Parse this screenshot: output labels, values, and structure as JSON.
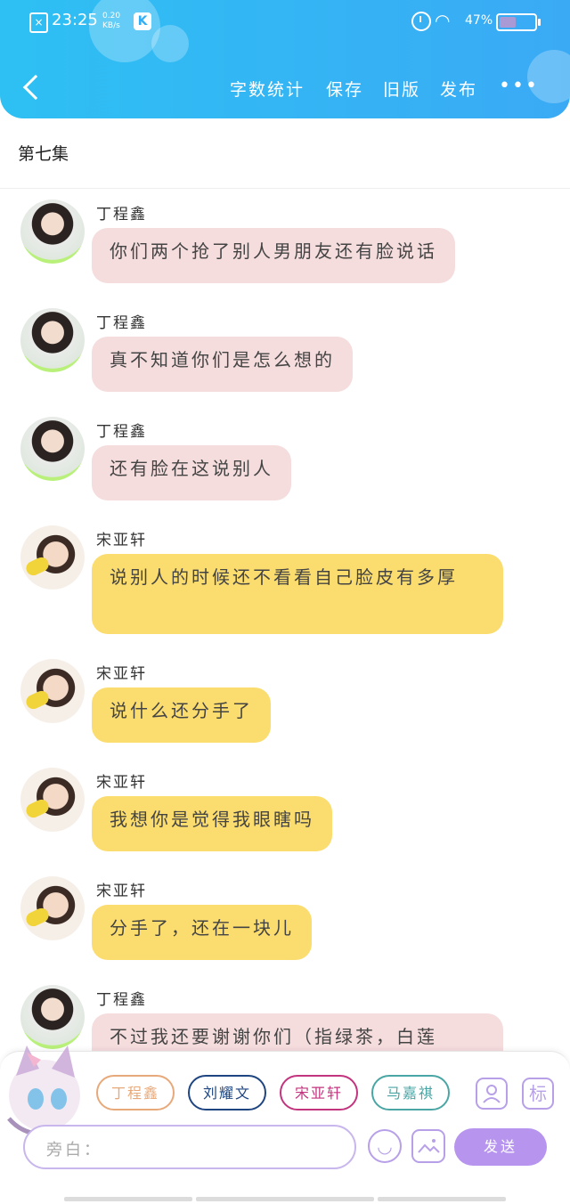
{
  "status_bar": {
    "time": "23:25",
    "speed_value": "0.20",
    "speed_unit": "KB/s",
    "app_badge": "K",
    "battery_pct": "47%",
    "battery_level": 0.47
  },
  "nav": {
    "word_count_label": "字数统计",
    "save_label": "保存",
    "old_version_label": "旧版",
    "publish_label": "发布",
    "more_label": "•••"
  },
  "episode_title": "第七集",
  "messages": [
    {
      "sender": "丁程鑫",
      "text": "你们两个抢了别人男朋友还有脸说话",
      "style": "pink"
    },
    {
      "sender": "丁程鑫",
      "text": "真不知道你们是怎么想的",
      "style": "pink"
    },
    {
      "sender": "丁程鑫",
      "text": "还有脸在这说别人",
      "style": "pink"
    },
    {
      "sender": "宋亚轩",
      "text": "说别人的时候还不看看自己脸皮有多厚",
      "style": "yellow"
    },
    {
      "sender": "宋亚轩",
      "text": "说什么还分手了",
      "style": "yellow"
    },
    {
      "sender": "宋亚轩",
      "text": "我想你是觉得我眼瞎吗",
      "style": "yellow"
    },
    {
      "sender": "宋亚轩",
      "text": "分手了，还在一块儿",
      "style": "yellow"
    },
    {
      "sender": "丁程鑫",
      "text": "不过我还要谢谢你们（指绿茶，白莲",
      "style": "pink"
    }
  ],
  "characters": [
    "丁程鑫",
    "刘耀文",
    "宋亚轩",
    "马嘉祺"
  ],
  "input": {
    "placeholder": "旁白："
  },
  "tag_label": "标",
  "send_label": "发送",
  "colors": {
    "header": "#2ec0f3",
    "pink_bubble": "#f5dcdd",
    "yellow_bubble": "#fbdc6e",
    "accent": "#b795ee"
  }
}
